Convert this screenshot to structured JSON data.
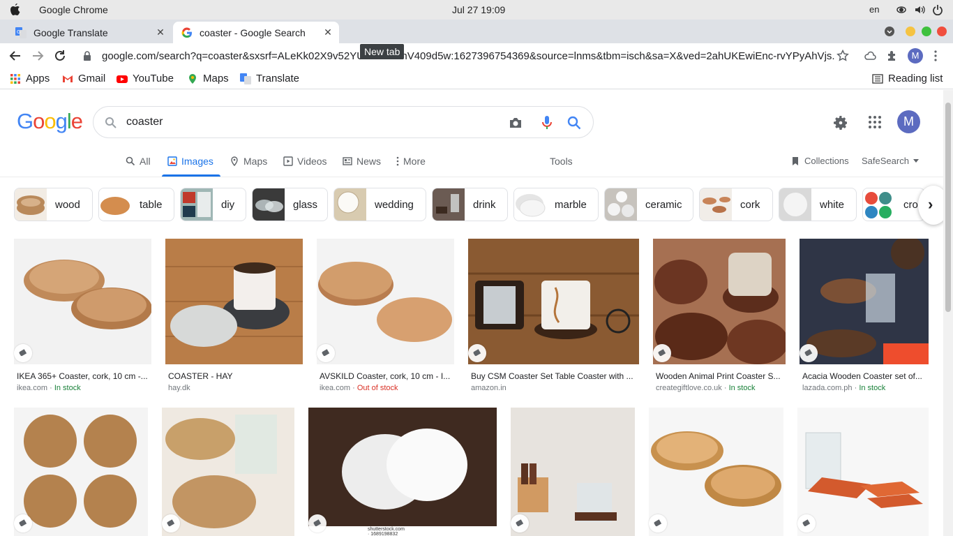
{
  "os": {
    "app_name": "Google Chrome",
    "clock": "Jul 27  19:09",
    "lang": "en"
  },
  "tabs": [
    {
      "title": "Google Translate"
    },
    {
      "title": "coaster - Google Search"
    }
  ],
  "tooltip": "New tab",
  "omnibox": {
    "url": "google.com/search?q=coaster&sxsrf=ALeKk02X9v52YUZ-KM...mV409d5w:1627396754369&source=lnms&tbm=isch&sa=X&ved=2ahUKEwiEnc-rvYPyAhVjs..."
  },
  "profile_initial": "M",
  "bookmarks": [
    {
      "label": "Apps"
    },
    {
      "label": "Gmail"
    },
    {
      "label": "YouTube"
    },
    {
      "label": "Maps"
    },
    {
      "label": "Translate"
    }
  ],
  "reading_list": "Reading list",
  "search": {
    "query": "coaster"
  },
  "nav": {
    "all": "All",
    "images": "Images",
    "maps": "Maps",
    "videos": "Videos",
    "news": "News",
    "more": "More",
    "tools": "Tools",
    "collections": "Collections",
    "safesearch": "SafeSearch"
  },
  "chips": [
    {
      "label": "wood",
      "color": "#b9895a"
    },
    {
      "label": "table",
      "color": "#d48d4e"
    },
    {
      "label": "diy",
      "color": "#9fb7b5"
    },
    {
      "label": "glass",
      "color": "#3a3a3a"
    },
    {
      "label": "wedding",
      "color": "#d8cbb0"
    },
    {
      "label": "drink",
      "color": "#6b5b53"
    },
    {
      "label": "marble",
      "color": "#e5e5e5"
    },
    {
      "label": "ceramic",
      "color": "#c7c3bd"
    },
    {
      "label": "cork",
      "color": "#f1ede8"
    },
    {
      "label": "white",
      "color": "#d9d9d9"
    },
    {
      "label": "cro",
      "color": "#3f8e8a"
    }
  ],
  "results_row1": [
    {
      "title": "IKEA 365+ Coaster, cork, 10 cm -...",
      "source": "ikea.com",
      "stock": "In stock",
      "bg": "#f2f2f2"
    },
    {
      "title": "COASTER - HAY",
      "source": "hay.dk",
      "stock": "",
      "bg": "#b97d48"
    },
    {
      "title": "AVSKILD Coaster, cork, 10 cm - I...",
      "source": "ikea.com",
      "stock": "Out of stock",
      "bg": "#f3f3f3"
    },
    {
      "title": "Buy CSM Coaster Set Table Coaster with ...",
      "source": "amazon.in",
      "stock": "",
      "bg": "#8a5a32"
    },
    {
      "title": "Wooden Animal Print Coaster S...",
      "source": "creategiftlove.co.uk",
      "stock": "In stock",
      "bg": "#a67052"
    },
    {
      "title": "Acacia Wooden Coaster set of...",
      "source": "lazada.com.ph",
      "stock": "In stock",
      "bg": "#2f3546"
    }
  ],
  "results_row2": [
    {
      "bg": "#f4f4f4"
    },
    {
      "bg": "#efe9e1"
    },
    {
      "bg": "#3f2a20"
    },
    {
      "bg": "#e7e3de"
    },
    {
      "bg": "#f6f6f6"
    },
    {
      "bg": "#f7f7f7"
    }
  ],
  "watermark": "shutterstock.com · 1689198832"
}
